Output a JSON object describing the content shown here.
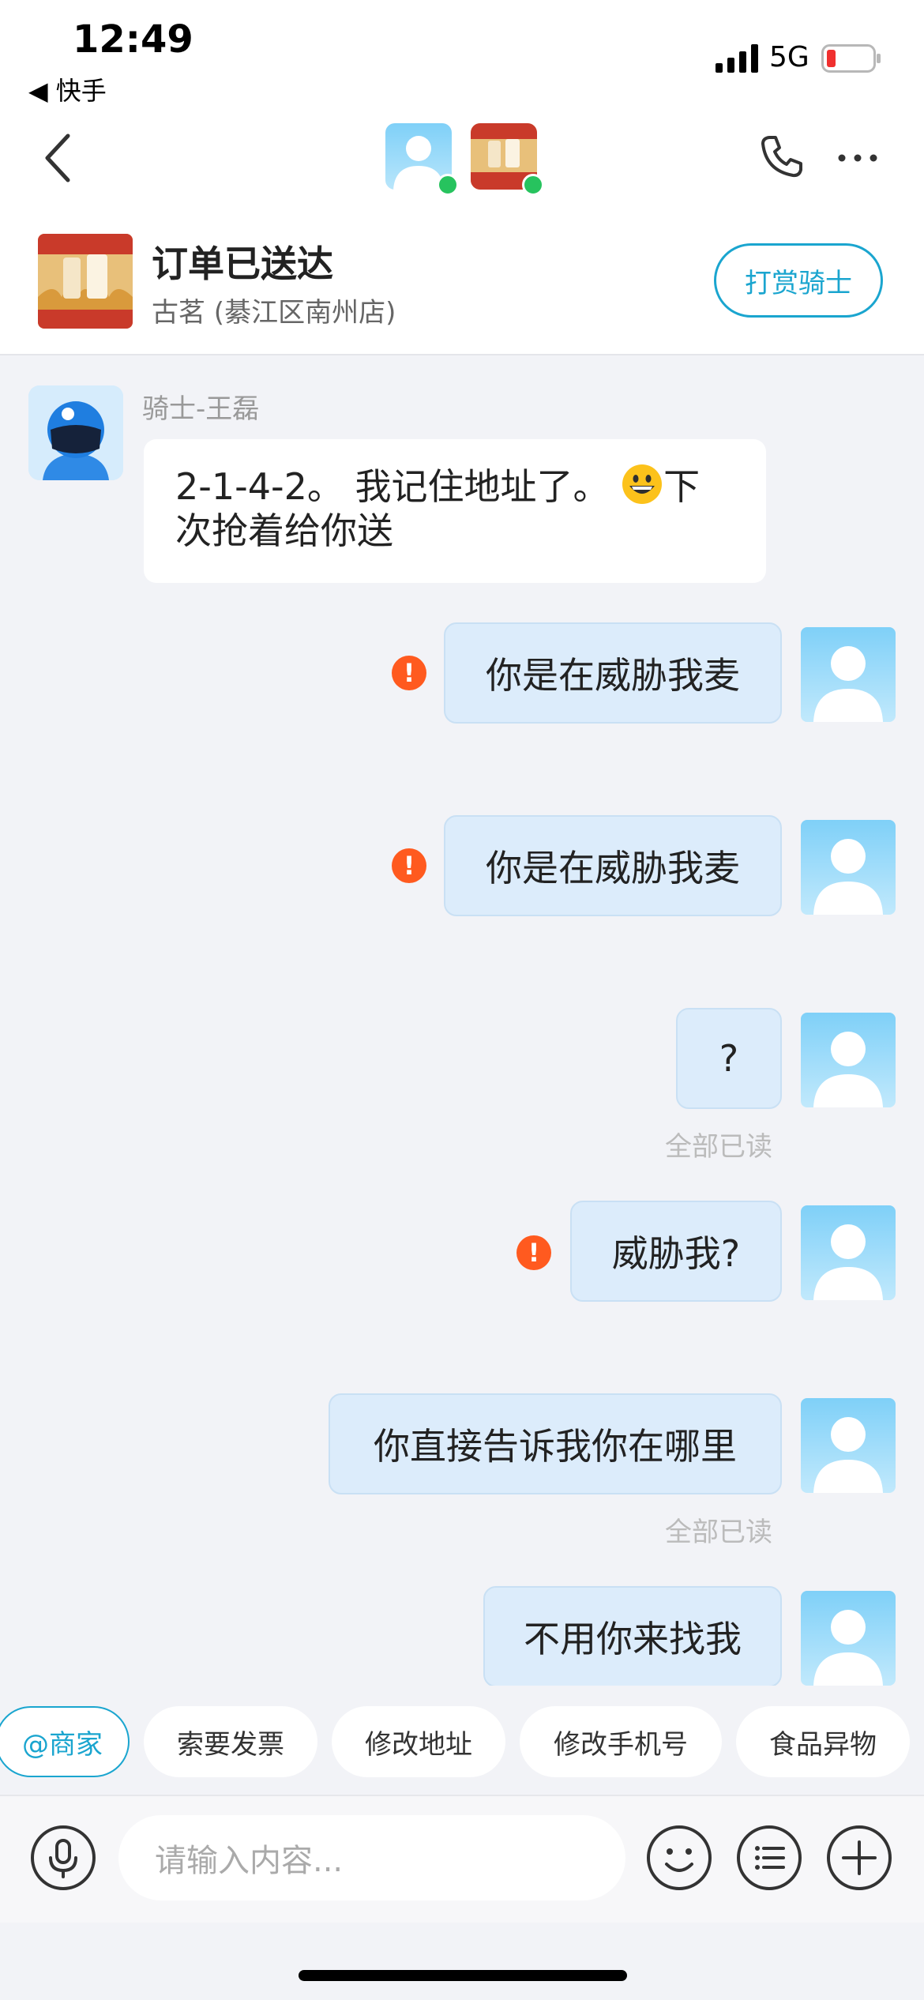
{
  "status_bar": {
    "time": "12:49",
    "back_app": "◀ 快手",
    "network": "5G"
  },
  "header": {
    "avatar1_icon": "user-avatar-icon",
    "avatar2_icon": "shop-logo-icon"
  },
  "order": {
    "title": "订单已送达",
    "shop": "古茗 (綦江区南州店)",
    "reward_button": "打赏骑士"
  },
  "chat": {
    "rider_name": "骑士-王磊",
    "rider_message_text": "2-1-4-2。 我记住地址了。",
    "rider_message_tail": "下次抢着给你送",
    "messages": [
      {
        "text": "你是在威胁我麦",
        "failed": true,
        "read": ""
      },
      {
        "text": "你是在威胁我麦",
        "failed": true,
        "read": ""
      },
      {
        "text": "?",
        "failed": false,
        "read": "全部已读"
      },
      {
        "text": "威胁我?",
        "failed": true,
        "read": ""
      },
      {
        "text": "你直接告诉我你在哪里",
        "failed": false,
        "read": "全部已读"
      },
      {
        "text": "不用你来找我",
        "failed": false,
        "read": ""
      }
    ],
    "error_mark": "!"
  },
  "quick_actions": [
    "@商家",
    "索要发票",
    "修改地址",
    "修改手机号",
    "食品异物"
  ],
  "input": {
    "placeholder": "请输入内容..."
  },
  "colors": {
    "accent": "#1aa5cf",
    "bubble_out": "#dcecfb",
    "error": "#ff5a1f",
    "online": "#27c35e"
  }
}
